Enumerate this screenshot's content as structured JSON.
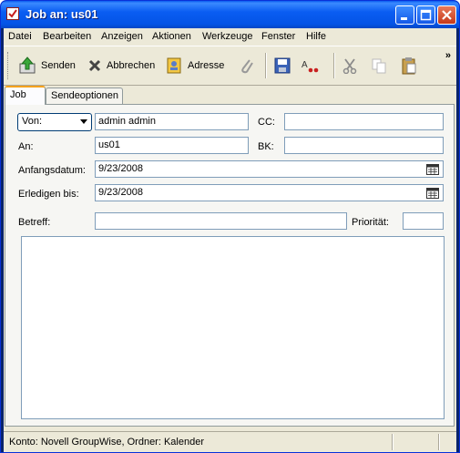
{
  "window": {
    "title": "Job an: us01"
  },
  "menu": [
    {
      "label": "Datei",
      "accel": "D"
    },
    {
      "label": "Bearbeiten",
      "accel": "B"
    },
    {
      "label": "Anzeigen",
      "accel": "A"
    },
    {
      "label": "Aktionen",
      "accel": "k"
    },
    {
      "label": "Werkzeuge",
      "accel": "W"
    },
    {
      "label": "Fenster",
      "accel": "F"
    },
    {
      "label": "Hilfe",
      "accel": "H"
    }
  ],
  "toolbar": {
    "send_label": "Senden",
    "cancel_label": "Abbrechen",
    "address_label": "Adresse",
    "overflow": "»"
  },
  "tabs": [
    {
      "label": "Job",
      "active": true
    },
    {
      "label": "Sendeoptionen",
      "active": false
    }
  ],
  "form": {
    "from_dropdown": "Von:",
    "from_value": "admin admin",
    "cc_label": "CC:",
    "cc_value": "",
    "to_label": "An:",
    "to_value": "us01",
    "bcc_label": "BK:",
    "bcc_value": "",
    "start_label": "Anfangsdatum:",
    "start_value": "9/23/2008",
    "due_label": "Erledigen bis:",
    "due_value": "9/23/2008",
    "subject_label": "Betreff:",
    "subject_value": "",
    "priority_label": "Priorität:",
    "priority_value": "",
    "body_value": ""
  },
  "status": {
    "text": "Konto: Novell GroupWise,  Ordner: Kalender"
  }
}
